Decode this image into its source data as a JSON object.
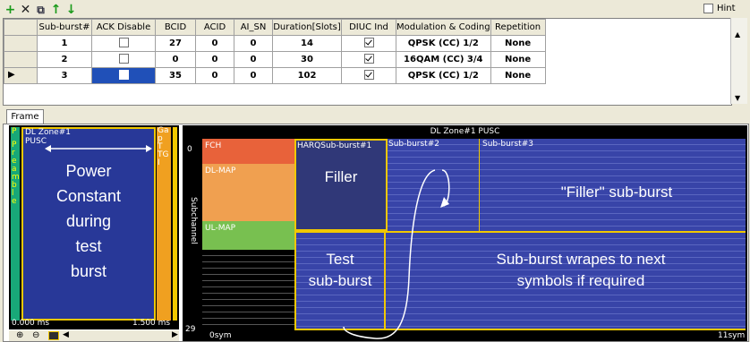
{
  "toolbar": {
    "add": "+",
    "delete": "✕",
    "copy": "⧉",
    "up": "↑",
    "down": "↓",
    "hint_label": "Hint"
  },
  "table": {
    "headers": [
      "Sub-burst#",
      "ACK Disable",
      "BCID",
      "ACID",
      "AI_SN",
      "Duration[Slots]",
      "DIUC Ind",
      "Modulation & Coding",
      "Repetition"
    ],
    "rows": [
      {
        "sub": "1",
        "bcid": "27",
        "acid": "0",
        "ai_sn": "0",
        "duration": "14",
        "mod": "QPSK (CC) 1/2",
        "rep": "None",
        "ack": false,
        "diuc": true
      },
      {
        "sub": "2",
        "bcid": "0",
        "acid": "0",
        "ai_sn": "0",
        "duration": "30",
        "mod": "16QAM (CC) 3/4",
        "rep": "None",
        "ack": false,
        "diuc": true
      },
      {
        "sub": "3",
        "bcid": "35",
        "acid": "0",
        "ai_sn": "0",
        "duration": "102",
        "mod": "QPSK (CC) 1/2",
        "rep": "None",
        "ack": false,
        "diuc": true
      }
    ]
  },
  "tab": {
    "frame": "Frame"
  },
  "mini": {
    "preamble": "Preamble",
    "p": "P",
    "zone": "DL Zone#1",
    "pusc": "PUSC",
    "gap": "Ga\np\nT\nTG\nI",
    "power_text": "Power\nConstant\nduring\ntest\nburst",
    "t_start": "0.000 ms",
    "t_end": "1.500 ms"
  },
  "main": {
    "zone_title": "DL Zone#1 PUSC",
    "y_top": "0",
    "y_bottom": "29",
    "y_axis": "Subchannel",
    "fch": "FCH",
    "dlmap": "DL-MAP",
    "ulmap": "UL-MAP",
    "harq": "HARQSub-burst#1",
    "sb2": "Sub-burst#2",
    "sb3": "Sub-burst#3",
    "filler": "Filler",
    "filler_sub": "\"Filler\" sub-burst",
    "test": "Test\nsub-burst",
    "wrap": "Sub-burst wrapes to next\nsymbols if required",
    "x_start": "0sym",
    "x_end": "11sym"
  },
  "colors": {
    "fch": "#e8623a",
    "dlmap": "#f0a050",
    "ulmap": "#78c050",
    "burst": "#3844a8",
    "frame_yellow": "#f0c800",
    "sel_blue": "#2050b8"
  }
}
